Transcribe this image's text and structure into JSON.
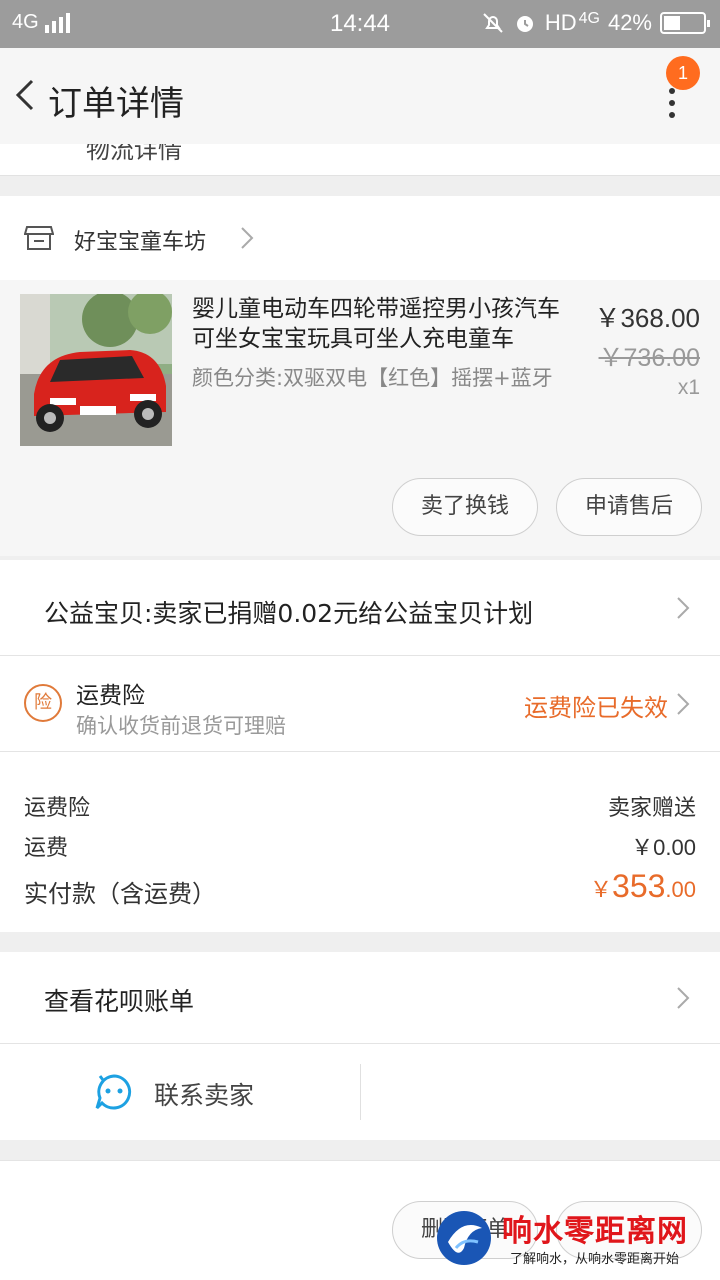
{
  "status_bar": {
    "network": "4G",
    "time": "14:44",
    "hd_label": "HD",
    "network_right": "4G",
    "battery": "42%"
  },
  "nav": {
    "title": "订单详情",
    "badge_count": "1",
    "cut_off_text": "物流详情"
  },
  "shop": {
    "name": "好宝宝童车坊"
  },
  "product": {
    "title": "婴儿童电动车四轮带遥控男小孩汽车可坐女宝宝玩具可坐人充电童车",
    "sku": "颜色分类:双驱双电【红色】摇摆+蓝牙",
    "price": "￥368.00",
    "original_price": "￥736.00",
    "quantity": "x1",
    "actions": {
      "sell_label": "卖了换钱",
      "after_sale_label": "申请售后"
    }
  },
  "charity": {
    "text": "公益宝贝:卖家已捐赠0.02元给公益宝贝计划"
  },
  "insurance": {
    "badge": "险",
    "title": "运费险",
    "subtitle": "确认收货前退货可理赔",
    "status": "运费险已失效"
  },
  "fees": {
    "rows": [
      {
        "label": "运费险",
        "value": "卖家赠送"
      },
      {
        "label": "运费",
        "value": "￥0.00"
      }
    ],
    "total_label": "实付款（含运费）",
    "total_currency": "￥",
    "total_integer": "353",
    "total_decimal": ".00"
  },
  "huabei": {
    "text": "查看花呗账单"
  },
  "contact": {
    "text": "联系卖家"
  },
  "bottom": {
    "delete_label": "删除订单"
  },
  "watermark": {
    "title": "响水零距离网",
    "subtitle": "了解响水，从响水零距离开始"
  },
  "colors": {
    "accent": "#e86b2a",
    "badge": "#ff6c1f",
    "status_bar": "#9c9c9c",
    "watermark_red": "#e0161b",
    "contact_icon": "#1da1e2"
  }
}
